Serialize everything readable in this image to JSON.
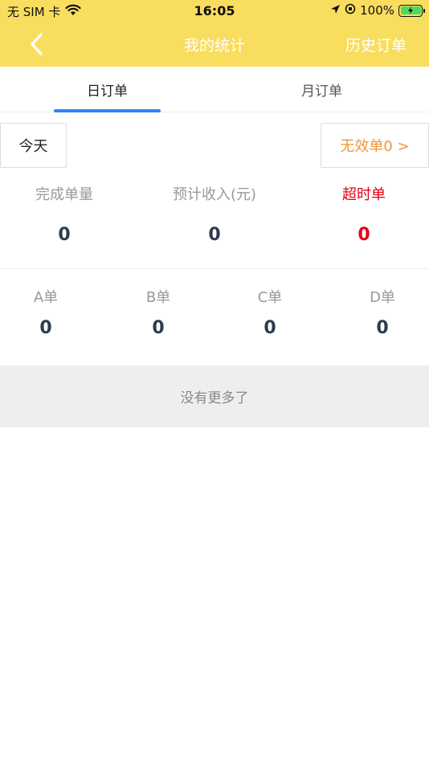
{
  "status_bar": {
    "carrier": "无 SIM 卡",
    "time": "16:05",
    "battery": "100%"
  },
  "nav": {
    "title": "我的统计",
    "right_action": "历史订单"
  },
  "tabs": [
    {
      "label": "日订单",
      "active": true
    },
    {
      "label": "月订单",
      "active": false
    }
  ],
  "filters": {
    "date_label": "今天",
    "invalid_orders_label": "无效单0 >"
  },
  "summary": [
    {
      "label": "完成单量",
      "value": "0"
    },
    {
      "label": "预计收入(元)",
      "value": "0"
    },
    {
      "label": "超时单",
      "value": "0"
    }
  ],
  "grades": [
    {
      "label": "A单",
      "value": "0"
    },
    {
      "label": "B单",
      "value": "0"
    },
    {
      "label": "C单",
      "value": "0"
    },
    {
      "label": "D单",
      "value": "0"
    }
  ],
  "footer_message": "没有更多了",
  "colors": {
    "header_bg": "#f9dd5e",
    "tab_indicator": "#2f86f6",
    "invalid_orders": "#f0973b",
    "overtime": "#e60012"
  }
}
